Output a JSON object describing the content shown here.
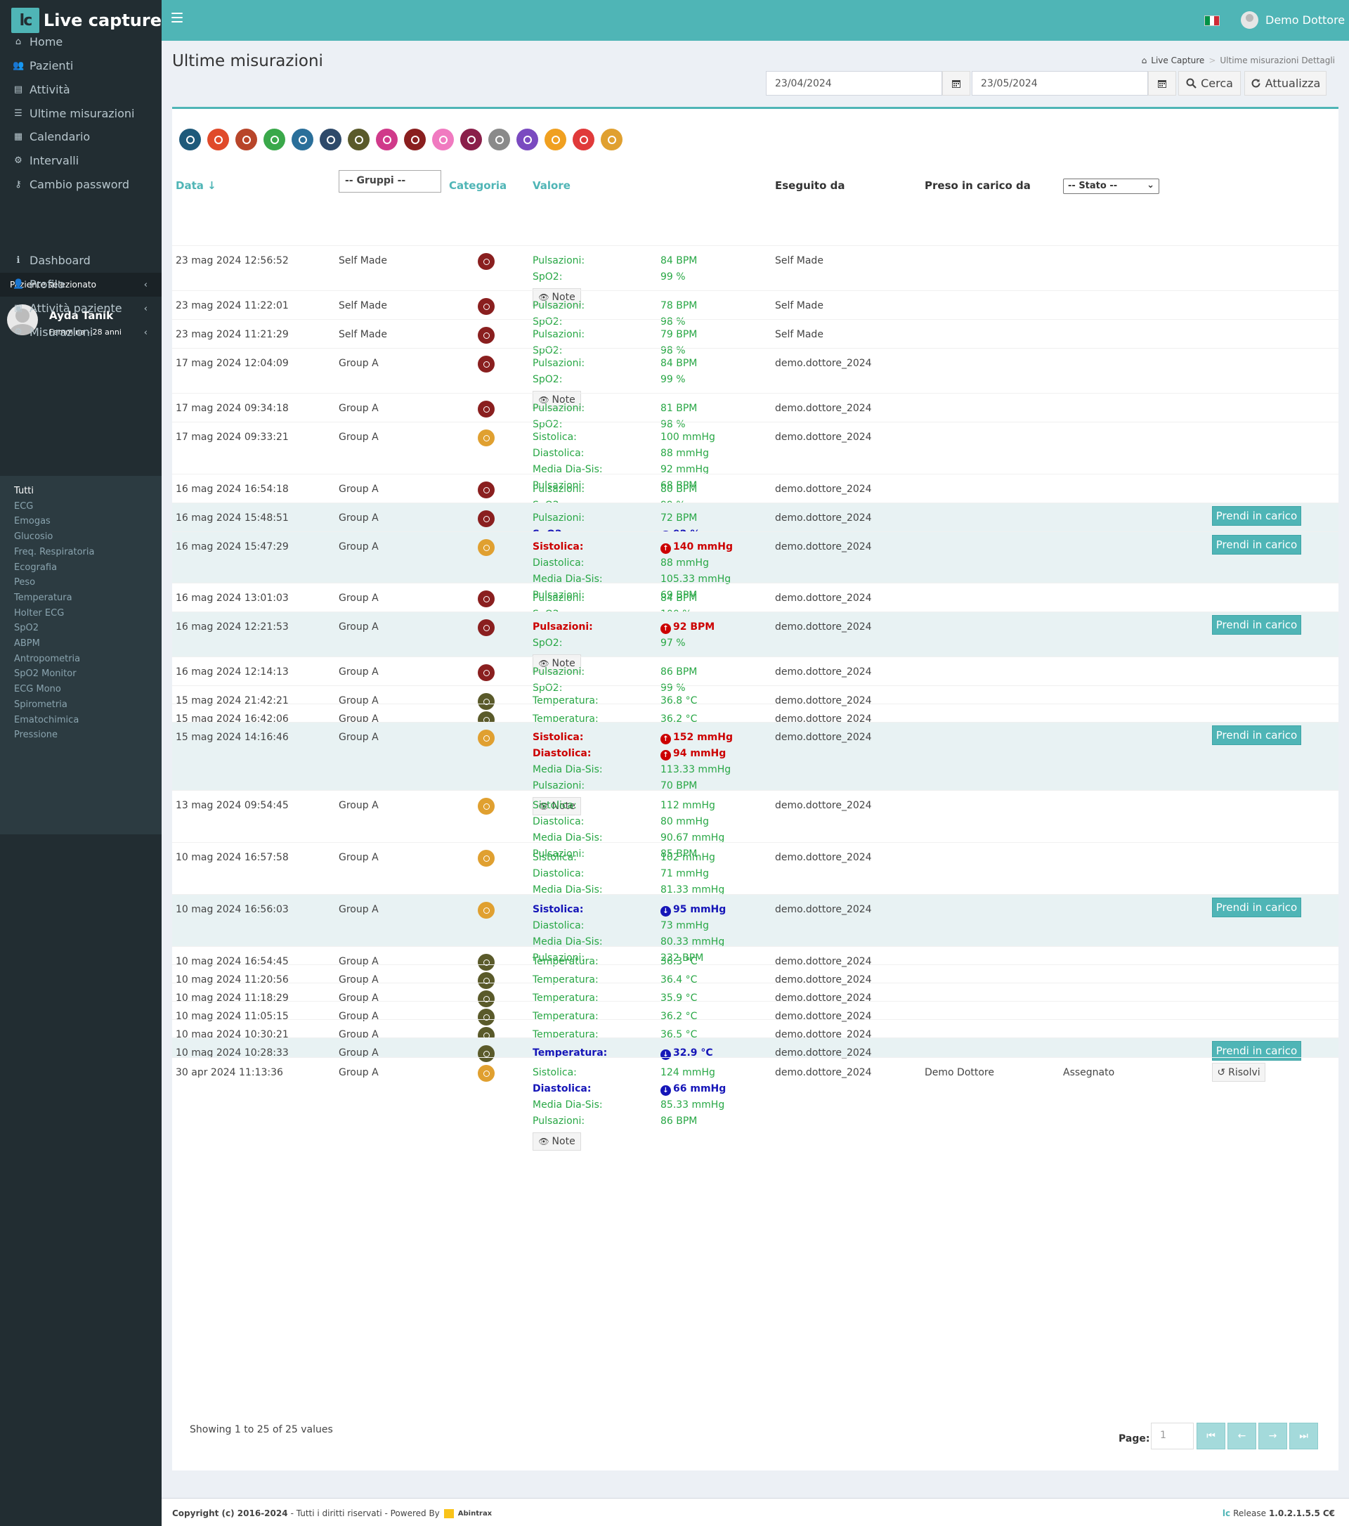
{
  "app": {
    "logo_mark": "lc",
    "name": "Live capture"
  },
  "topbar": {
    "user": "Demo Dottore",
    "flag_colors": [
      "#009246",
      "#ffffff",
      "#ce2b37"
    ]
  },
  "sidebar": {
    "items": [
      {
        "label": "Home",
        "icon": "home-icon",
        "glyph": "⌂"
      },
      {
        "label": "Pazienti",
        "icon": "users-icon",
        "glyph": "👥"
      },
      {
        "label": "Attività",
        "icon": "list-alt-icon",
        "glyph": "▤"
      },
      {
        "label": "Ultime misurazioni",
        "icon": "list-icon",
        "glyph": "☰"
      },
      {
        "label": "Calendario",
        "icon": "calendar-icon",
        "glyph": "▦"
      },
      {
        "label": "Intervalli",
        "icon": "gear-icon",
        "glyph": "⚙"
      },
      {
        "label": "Cambio password",
        "icon": "key-icon",
        "glyph": "⚷"
      }
    ],
    "section_header": "Paziente selezionato",
    "patient": {
      "name": "Ayda Tanik",
      "sub": "Femmina - 28 anni"
    },
    "patient_items": [
      {
        "label": "Dashboard",
        "icon": "info-icon",
        "glyph": "ℹ"
      },
      {
        "label": "Profilo",
        "icon": "user-icon",
        "glyph": "👤"
      },
      {
        "label": "Attività paziente",
        "icon": "briefcase-icon",
        "glyph": "▣"
      },
      {
        "label": "Misurazioni",
        "icon": "gear-icon",
        "glyph": "⚙"
      }
    ],
    "submenu": [
      "Tutti",
      "ECG",
      "Emogas",
      "Glucosio",
      "Freq. Respiratoria",
      "Ecografia",
      "Peso",
      "Temperatura",
      "Holter ECG",
      "SpO2",
      "ABPM",
      "Antropometria",
      "SpO2 Monitor",
      "ECG Mono",
      "Spirometria",
      "Ematochimica",
      "Pressione"
    ]
  },
  "page": {
    "title": "Ultime misurazioni",
    "breadcrumb": {
      "home": "Live Capture",
      "current": "Ultime misurazioni Dettagli"
    },
    "date_from": "23/04/2024",
    "date_to": "23/05/2024",
    "search_label": "Cerca",
    "refresh_label": "Attualizza"
  },
  "category_icons": [
    {
      "name": "ecg-icon",
      "color": "#1f5a7a"
    },
    {
      "name": "blood-drop-icon",
      "color": "#e04a2a"
    },
    {
      "name": "glucose-icon",
      "color": "#b8452a"
    },
    {
      "name": "lungs-icon",
      "color": "#3aa84a"
    },
    {
      "name": "ultrasound-icon",
      "color": "#2a6f9a"
    },
    {
      "name": "weight-icon",
      "color": "#2e4a6a"
    },
    {
      "name": "thermometer-icon",
      "color": "#5a5a2a"
    },
    {
      "name": "holter-icon",
      "color": "#d03a8a"
    },
    {
      "name": "spo2-icon",
      "color": "#8a1f1f"
    },
    {
      "name": "abpm-icon",
      "color": "#f07ac0"
    },
    {
      "name": "anthropometry-icon",
      "color": "#8a1f4a"
    },
    {
      "name": "spo2-monitor-icon",
      "color": "#8a8a8a"
    },
    {
      "name": "ecg-mono-icon",
      "color": "#7a4ac0"
    },
    {
      "name": "spirometry-icon",
      "color": "#f0a020"
    },
    {
      "name": "lab-icon",
      "color": "#e03a3a"
    },
    {
      "name": "pressure-icon",
      "color": "#e0a030"
    }
  ],
  "table": {
    "headers": {
      "date": "Data",
      "category": "Categoria",
      "value": "Valore",
      "executed_by": "Eseguito da",
      "taken_by": "Preso in carico da"
    },
    "group_filter": "-- Gruppi --",
    "status_filter": "-- Stato --",
    "note_label": "Note",
    "take_label": "Prendi in carico",
    "solve_label": "Risolvi"
  },
  "rows": [
    {
      "date": "23 mag 2024 12:56:52",
      "group": "Self Made",
      "cat": "spo2",
      "labels": [
        "Pulsazioni:",
        "SpO2:"
      ],
      "values": [
        "84 BPM",
        "99 %"
      ],
      "flags": [
        "",
        ""
      ],
      "by": "Self Made",
      "note": true,
      "take": false
    },
    {
      "date": "23 mag 2024 11:22:01",
      "group": "Self Made",
      "cat": "spo2",
      "labels": [
        "Pulsazioni:",
        "SpO2:"
      ],
      "values": [
        "78 BPM",
        "98 %"
      ],
      "flags": [
        "",
        ""
      ],
      "by": "Self Made",
      "note": false,
      "take": false
    },
    {
      "date": "23 mag 2024 11:21:29",
      "group": "Self Made",
      "cat": "spo2",
      "labels": [
        "Pulsazioni:",
        "SpO2:"
      ],
      "values": [
        "79 BPM",
        "98 %"
      ],
      "flags": [
        "",
        ""
      ],
      "by": "Self Made",
      "note": false,
      "take": false
    },
    {
      "date": "17 mag 2024 12:04:09",
      "group": "Group A",
      "cat": "spo2",
      "labels": [
        "Pulsazioni:",
        "SpO2:"
      ],
      "values": [
        "84 BPM",
        "99 %"
      ],
      "flags": [
        "",
        ""
      ],
      "by": "demo.dottore_2024",
      "note": true,
      "take": false
    },
    {
      "date": "17 mag 2024 09:34:18",
      "group": "Group A",
      "cat": "spo2",
      "labels": [
        "Pulsazioni:",
        "SpO2:"
      ],
      "values": [
        "81 BPM",
        "98 %"
      ],
      "flags": [
        "",
        ""
      ],
      "by": "demo.dottore_2024",
      "note": false,
      "take": false
    },
    {
      "date": "17 mag 2024 09:33:21",
      "group": "Group A",
      "cat": "pressure",
      "labels": [
        "Sistolica:",
        "Diastolica:",
        "Media Dia-Sis:",
        "Pulsazioni:"
      ],
      "values": [
        "100 mmHg",
        "88 mmHg",
        "92 mmHg",
        "68 BPM"
      ],
      "flags": [
        "",
        "",
        "",
        ""
      ],
      "by": "demo.dottore_2024",
      "note": false,
      "take": false
    },
    {
      "date": "16 mag 2024 16:54:18",
      "group": "Group A",
      "cat": "spo2",
      "labels": [
        "Pulsazioni:",
        "SpO2:"
      ],
      "values": [
        "80 BPM",
        "99 %"
      ],
      "flags": [
        "",
        ""
      ],
      "by": "demo.dottore_2024",
      "note": false,
      "take": false
    },
    {
      "date": "16 mag 2024 15:48:51",
      "group": "Group A",
      "cat": "spo2",
      "labels": [
        "Pulsazioni:",
        "SpO2:"
      ],
      "values": [
        "72 BPM",
        "92 %"
      ],
      "flags": [
        "",
        "low"
      ],
      "by": "demo.dottore_2024",
      "note": false,
      "take": true
    },
    {
      "date": "16 mag 2024 15:47:29",
      "group": "Group A",
      "cat": "pressure",
      "labels": [
        "Sistolica:",
        "Diastolica:",
        "Media Dia-Sis:",
        "Pulsazioni:"
      ],
      "values": [
        "140 mmHg",
        "88 mmHg",
        "105.33 mmHg",
        "69 BPM"
      ],
      "flags": [
        "high",
        "",
        "",
        ""
      ],
      "by": "demo.dottore_2024",
      "note": false,
      "take": true
    },
    {
      "date": "16 mag 2024 13:01:03",
      "group": "Group A",
      "cat": "spo2",
      "labels": [
        "Pulsazioni:",
        "SpO2:"
      ],
      "values": [
        "84 BPM",
        "100 %"
      ],
      "flags": [
        "",
        ""
      ],
      "by": "demo.dottore_2024",
      "note": false,
      "take": false
    },
    {
      "date": "16 mag 2024 12:21:53",
      "group": "Group A",
      "cat": "spo2",
      "labels": [
        "Pulsazioni:",
        "SpO2:"
      ],
      "values": [
        "92 BPM",
        "97 %"
      ],
      "flags": [
        "high",
        ""
      ],
      "by": "demo.dottore_2024",
      "note": true,
      "take": true
    },
    {
      "date": "16 mag 2024 12:14:13",
      "group": "Group A",
      "cat": "spo2",
      "labels": [
        "Pulsazioni:",
        "SpO2:"
      ],
      "values": [
        "86 BPM",
        "99 %"
      ],
      "flags": [
        "",
        ""
      ],
      "by": "demo.dottore_2024",
      "note": false,
      "take": false
    },
    {
      "date": "15 mag 2024 21:42:21",
      "group": "Group A",
      "cat": "temp",
      "labels": [
        "Temperatura:"
      ],
      "values": [
        "36.8 °C"
      ],
      "flags": [
        ""
      ],
      "by": "demo.dottore_2024",
      "note": false,
      "take": false
    },
    {
      "date": "15 mag 2024 16:42:06",
      "group": "Group A",
      "cat": "temp",
      "labels": [
        "Temperatura:"
      ],
      "values": [
        "36.2 °C"
      ],
      "flags": [
        ""
      ],
      "by": "demo.dottore_2024",
      "note": false,
      "take": false
    },
    {
      "date": "15 mag 2024 14:16:46",
      "group": "Group A",
      "cat": "pressure",
      "labels": [
        "Sistolica:",
        "Diastolica:",
        "Media Dia-Sis:",
        "Pulsazioni:"
      ],
      "values": [
        "152 mmHg",
        "94 mmHg",
        "113.33 mmHg",
        "70 BPM"
      ],
      "flags": [
        "high",
        "high",
        "",
        ""
      ],
      "by": "demo.dottore_2024",
      "note": true,
      "take": true
    },
    {
      "date": "13 mag 2024 09:54:45",
      "group": "Group A",
      "cat": "pressure",
      "labels": [
        "Sistolica:",
        "Diastolica:",
        "Media Dia-Sis:",
        "Pulsazioni:"
      ],
      "values": [
        "112 mmHg",
        "80 mmHg",
        "90.67 mmHg",
        "85 BPM"
      ],
      "flags": [
        "",
        "",
        "",
        ""
      ],
      "by": "demo.dottore_2024",
      "note": false,
      "take": false
    },
    {
      "date": "10 mag 2024 16:57:58",
      "group": "Group A",
      "cat": "pressure",
      "labels": [
        "Sistolica:",
        "Diastolica:",
        "Media Dia-Sis:",
        "Pulsazioni:"
      ],
      "values": [
        "102 mmHg",
        "71 mmHg",
        "81.33 mmHg",
        "232 BPM"
      ],
      "flags": [
        "",
        "",
        "",
        ""
      ],
      "by": "demo.dottore_2024",
      "note": false,
      "take": false
    },
    {
      "date": "10 mag 2024 16:56:03",
      "group": "Group A",
      "cat": "pressure",
      "labels": [
        "Sistolica:",
        "Diastolica:",
        "Media Dia-Sis:",
        "Pulsazioni:"
      ],
      "values": [
        "95 mmHg",
        "73 mmHg",
        "80.33 mmHg",
        "232 BPM"
      ],
      "flags": [
        "low",
        "",
        "",
        ""
      ],
      "by": "demo.dottore_2024",
      "note": false,
      "take": true
    },
    {
      "date": "10 mag 2024 16:54:45",
      "group": "Group A",
      "cat": "temp",
      "labels": [
        "Temperatura:"
      ],
      "values": [
        "36.3 °C"
      ],
      "flags": [
        ""
      ],
      "by": "demo.dottore_2024",
      "note": false,
      "take": false
    },
    {
      "date": "10 mag 2024 11:20:56",
      "group": "Group A",
      "cat": "temp",
      "labels": [
        "Temperatura:"
      ],
      "values": [
        "36.4 °C"
      ],
      "flags": [
        ""
      ],
      "by": "demo.dottore_2024",
      "note": false,
      "take": false
    },
    {
      "date": "10 mag 2024 11:18:29",
      "group": "Group A",
      "cat": "temp",
      "labels": [
        "Temperatura:"
      ],
      "values": [
        "35.9 °C"
      ],
      "flags": [
        ""
      ],
      "by": "demo.dottore_2024",
      "note": false,
      "take": false
    },
    {
      "date": "10 mag 2024 11:05:15",
      "group": "Group A",
      "cat": "temp",
      "labels": [
        "Temperatura:"
      ],
      "values": [
        "36.2 °C"
      ],
      "flags": [
        ""
      ],
      "by": "demo.dottore_2024",
      "note": false,
      "take": false
    },
    {
      "date": "10 mag 2024 10:30:21",
      "group": "Group A",
      "cat": "temp",
      "labels": [
        "Temperatura:"
      ],
      "values": [
        "36.5 °C"
      ],
      "flags": [
        ""
      ],
      "by": "demo.dottore_2024",
      "note": false,
      "take": false
    },
    {
      "date": "10 mag 2024 10:28:33",
      "group": "Group A",
      "cat": "temp",
      "labels": [
        "Temperatura:"
      ],
      "values": [
        "32.9 °C"
      ],
      "flags": [
        "low"
      ],
      "by": "demo.dottore_2024",
      "note": false,
      "take": true
    },
    {
      "date": "30 apr 2024 11:13:36",
      "group": "Group A",
      "cat": "pressure",
      "labels": [
        "Sistolica:",
        "Diastolica:",
        "Media Dia-Sis:",
        "Pulsazioni:"
      ],
      "values": [
        "124 mmHg",
        "66 mmHg",
        "85.33 mmHg",
        "86 BPM"
      ],
      "flags": [
        "",
        "low",
        "",
        ""
      ],
      "by": "demo.dottore_2024",
      "taken_by": "Demo Dottore",
      "status": "Assegnato",
      "note": true,
      "take": false,
      "solve": true
    }
  ],
  "pagination": {
    "showing": "Showing 1 to 25 of 25 values",
    "page_label": "Page:",
    "page": "1"
  },
  "footer": {
    "copyright": "Copyright (c) 2016-2024",
    "rights": " - Tutti i diritti riservati - Powered By",
    "powered": "Abintrax",
    "release_label": "Release",
    "release": "1.0.2.1.5.5",
    "ce": "C€"
  },
  "colors": {
    "teal": "#4fb5b6",
    "sidebar": "#222d32",
    "ok_green": "#28a745",
    "alert_red": "#cc0000",
    "alert_blue": "#1616b8",
    "spo2_cat": "#8a1f1f",
    "pressure_cat": "#e0a030",
    "temp_cat": "#5a5a2a"
  }
}
